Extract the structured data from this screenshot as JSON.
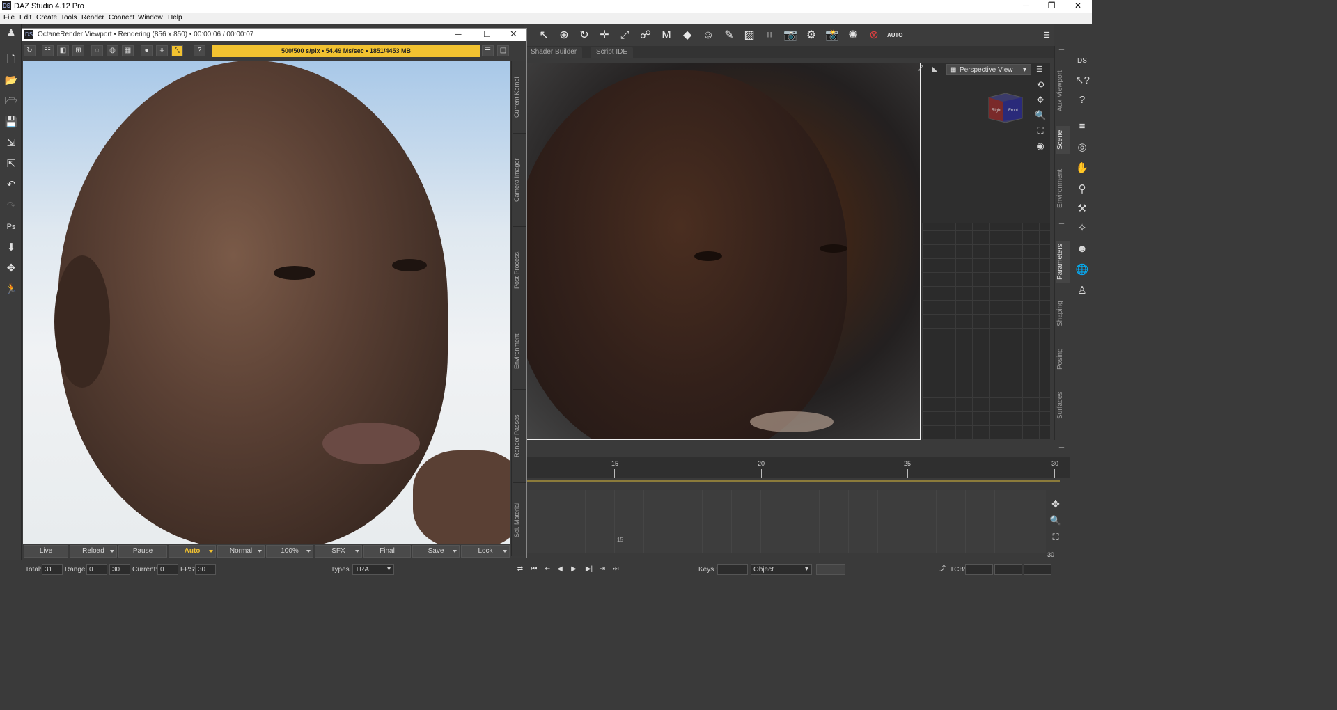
{
  "app": {
    "title": "DAZ Studio 4.12 Pro",
    "icon_label": "DS"
  },
  "menu": [
    "File",
    "Edit",
    "Create",
    "Tools",
    "Render",
    "Connect",
    "Window",
    "Help"
  ],
  "octane": {
    "title": "OctaneRender Viewport • Rendering (856 x 850) • 00:00:06 / 00:00:07",
    "progress_text": "500/500 s/pix • 54.49 Ms/sec • 1851/4453 MB",
    "progress": 1.0,
    "side_tabs": [
      "Current Kernel",
      "Camera Imager",
      "Post Process.",
      "Environment",
      "Render Passes",
      "Sel. Material"
    ],
    "bottom_buttons": [
      {
        "label": "Live"
      },
      {
        "label": "Reload"
      },
      {
        "label": "Pause"
      },
      {
        "label": "Auto"
      },
      {
        "label": "Normal"
      },
      {
        "label": "100%"
      },
      {
        "label": "SFX"
      },
      {
        "label": "Final"
      },
      {
        "label": "Save"
      },
      {
        "label": "Lock"
      }
    ]
  },
  "tabs": [
    "Shader Builder",
    "Script IDE"
  ],
  "viewport": {
    "view_select": "Perspective View",
    "cube_labels": [
      "Right",
      "Front"
    ]
  },
  "right_tabs": [
    "Aux Viewport",
    "Scene",
    "Environment",
    "Parameters",
    "Shaping",
    "Posing",
    "Surfaces"
  ],
  "timeline": {
    "ticks": [
      "15",
      "20",
      "25",
      "30"
    ],
    "row_label": "15",
    "end_label": "30"
  },
  "status": {
    "total_label": "Total:",
    "total": "31",
    "range_label": "Range:",
    "range_start": "0",
    "range_end": "30",
    "current_label": "Current:",
    "current": "0",
    "fps_label": "FPS:",
    "fps": "30",
    "types_label": "Types :",
    "types_value": "TRA",
    "keys_label": "Keys :",
    "object_value": "Object",
    "tcb_label": "TCB:"
  },
  "colors": {
    "accent": "#f2c230",
    "panel": "#3a3a3a"
  }
}
